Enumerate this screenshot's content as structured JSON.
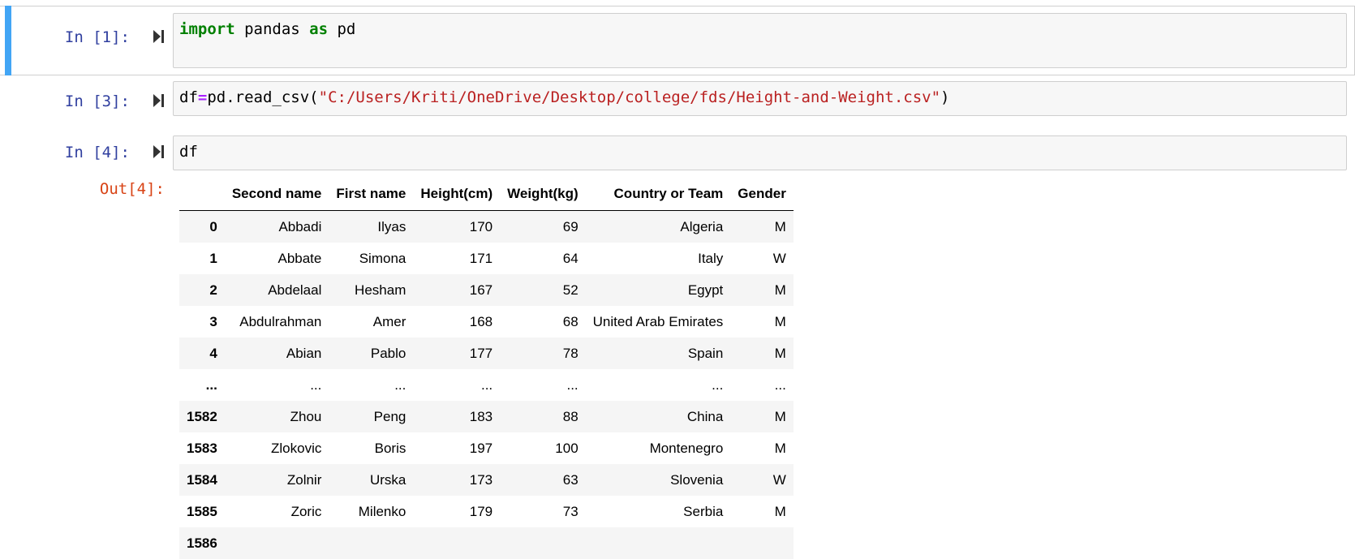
{
  "cells": [
    {
      "prompt": "In [1]:",
      "code_tokens": [
        {
          "t": "import",
          "c": "kw"
        },
        {
          "t": " pandas ",
          "c": ""
        },
        {
          "t": "as",
          "c": "kw"
        },
        {
          "t": " pd",
          "c": ""
        }
      ]
    },
    {
      "prompt": "In [3]:",
      "code_tokens": [
        {
          "t": "df",
          "c": ""
        },
        {
          "t": "=",
          "c": "op"
        },
        {
          "t": "pd.read_csv(",
          "c": ""
        },
        {
          "t": "\"C:/Users/Kriti/OneDrive/Desktop/college/fds/Height-and-Weight.csv\"",
          "c": "str"
        },
        {
          "t": ")",
          "c": ""
        }
      ]
    },
    {
      "prompt": "In [4]:",
      "code_tokens": [
        {
          "t": "df",
          "c": ""
        }
      ]
    }
  ],
  "output": {
    "prompt": "Out[4]:",
    "columns": [
      "",
      "Second name",
      "First name",
      "Height(cm)",
      "Weight(kg)",
      "Country or Team",
      "Gender"
    ],
    "rows": [
      [
        "0",
        "Abbadi",
        "Ilyas",
        "170",
        "69",
        "Algeria",
        "M"
      ],
      [
        "1",
        "Abbate",
        "Simona",
        "171",
        "64",
        "Italy",
        "W"
      ],
      [
        "2",
        "Abdelaal",
        "Hesham",
        "167",
        "52",
        "Egypt",
        "M"
      ],
      [
        "3",
        "Abdulrahman",
        "Amer",
        "168",
        "68",
        "United Arab Emirates",
        "M"
      ],
      [
        "4",
        "Abian",
        "Pablo",
        "177",
        "78",
        "Spain",
        "M"
      ],
      [
        "...",
        "...",
        "...",
        "...",
        "...",
        "...",
        "..."
      ],
      [
        "1582",
        "Zhou",
        "Peng",
        "183",
        "88",
        "China",
        "M"
      ],
      [
        "1583",
        "Zlokovic",
        "Boris",
        "197",
        "100",
        "Montenegro",
        "M"
      ],
      [
        "1584",
        "Zolnir",
        "Urska",
        "173",
        "63",
        "Slovenia",
        "W"
      ],
      [
        "1585",
        "Zoric",
        "Milenko",
        "179",
        "73",
        "Serbia",
        "M"
      ],
      [
        "1586",
        "",
        "",
        "",
        "",
        "",
        ""
      ]
    ]
  },
  "icons": {
    "run": "run-cell-icon"
  },
  "colors": {
    "selected_bar": "#42a5f5",
    "in_prompt": "#303f9f",
    "out_prompt": "#d84315"
  }
}
